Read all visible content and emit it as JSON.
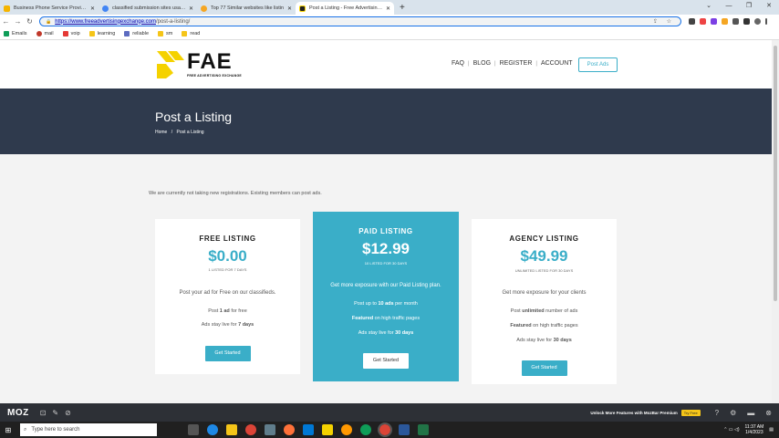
{
  "browser": {
    "tabs": [
      {
        "title": "Business Phone Service Provider",
        "color": "#f5b400",
        "active": false
      },
      {
        "title": "classified submission sites usa 20",
        "color": "#4285f4",
        "active": false
      },
      {
        "title": "Top 77 Similar websites like listin",
        "color": "#f5a623",
        "active": false
      },
      {
        "title": "Post a Listing - Free Advertising E",
        "color": "#222222",
        "active": true
      }
    ],
    "new_tab": "+",
    "url_highlight": "https://www.freeadvertisingexchange.com",
    "url_rest": "/post-a-listing/",
    "bookmarks": [
      "Emails",
      "mail",
      "voip",
      "learning",
      "reliable",
      "sm",
      "read"
    ]
  },
  "site": {
    "logo_text": "FAE",
    "logo_sub": "FREE ADVERTISING EXCHANGE",
    "nav": [
      "FAQ",
      "BLOG",
      "REGISTER",
      "ACCOUNT"
    ],
    "post_ads": "Post Ads",
    "hero_title": "Post a Listing",
    "breadcrumb_home": "Home",
    "breadcrumb_sep": "/",
    "breadcrumb_current": "Post a Listing",
    "notice": "We are currently not taking new registrations. Existing members can post ads."
  },
  "plans": {
    "free": {
      "title": "FREE LISTING",
      "price": "$0.00",
      "sub": "1 LISTED FOR 7 DAYS",
      "desc": "Post your ad for Free on our classifieds.",
      "f1_pre": "Post ",
      "f1_bold": "1 ad",
      "f1_post": " for free",
      "f2_pre": "Ads stay live for ",
      "f2_bold": "7 days",
      "button": "Get Started"
    },
    "paid": {
      "title": "PAID LISTING",
      "price": "$12.99",
      "sub": "10 LISTED FOR 30 DAYS",
      "desc": "Get more exposure with our Paid Listing plan.",
      "f1_pre": "Post up to ",
      "f1_bold": "10 ads",
      "f1_post": " per month",
      "f2_bold": "Featured",
      "f2_post": " on high traffic pages",
      "f3_pre": "Ads stay live for ",
      "f3_bold": "30 days",
      "button": "Get Started"
    },
    "agency": {
      "title": "AGENCY LISTING",
      "price": "$49.99",
      "sub": "UNLIMITED LISTED FOR 30 DAYS",
      "desc": "Get more exposure for your clients",
      "f1_pre": "Post ",
      "f1_bold": "unlimited",
      "f1_post": " number of ads",
      "f2_bold": "Featured",
      "f2_post": " on high traffic pages",
      "f3_pre": "Ads stay live for ",
      "f3_bold": "30 days",
      "button": "Get Started"
    }
  },
  "mozbar": {
    "logo": "MOZ",
    "upsell": "Unlock More Features with MozBar Premium",
    "try": "Try Free"
  },
  "taskbar": {
    "search_placeholder": "Type here to search",
    "time": "11:37 AM",
    "date": "1/4/2023"
  },
  "colors": {
    "accent": "#3aaec8",
    "hero_bg": "#2f3a4d",
    "logo_yellow": "#f5d200"
  }
}
